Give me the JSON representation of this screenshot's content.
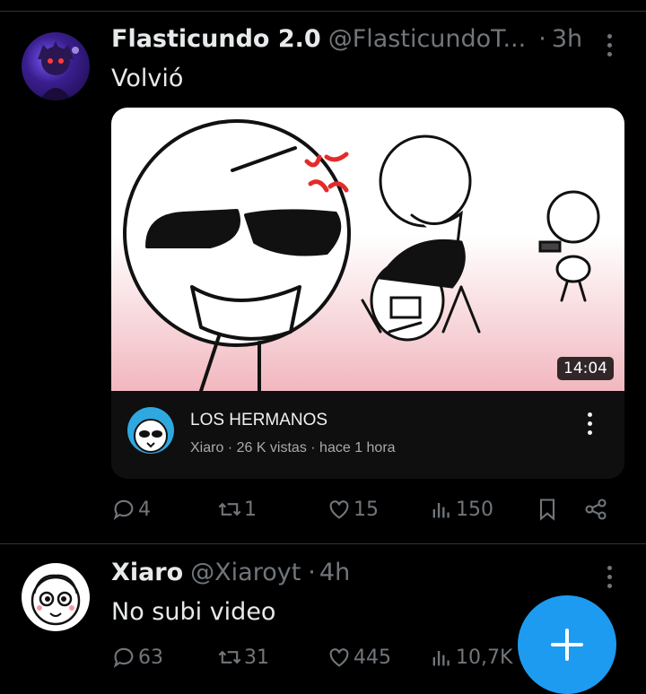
{
  "post1": {
    "name": "Flasticundo 2.0",
    "handle": "@FlasticundoT...",
    "separator": "·",
    "time": "3h",
    "text": "Volvió",
    "video": {
      "duration": "14:04",
      "title": "LOS HERMANOS",
      "meta": "Xiaro · 26 K vistas · hace 1 hora"
    },
    "actions": {
      "replies": "4",
      "reposts": "1",
      "likes": "15",
      "views": "150"
    }
  },
  "post2": {
    "name": "Xiaro",
    "handle": "@Xiaroyt",
    "separator": "·",
    "time": "4h",
    "text": "No subi video",
    "actions": {
      "replies": "63",
      "reposts": "31",
      "likes": "445",
      "views": "10,7K"
    }
  },
  "colors": {
    "background": "#000000",
    "muted": "#71767b",
    "accent": "#1d9bf0",
    "text": "#e7e9ea"
  },
  "icons": [
    "reply-icon",
    "repost-icon",
    "like-icon",
    "views-icon",
    "bookmark-icon",
    "share-icon",
    "more-icon",
    "compose-plus-icon"
  ]
}
